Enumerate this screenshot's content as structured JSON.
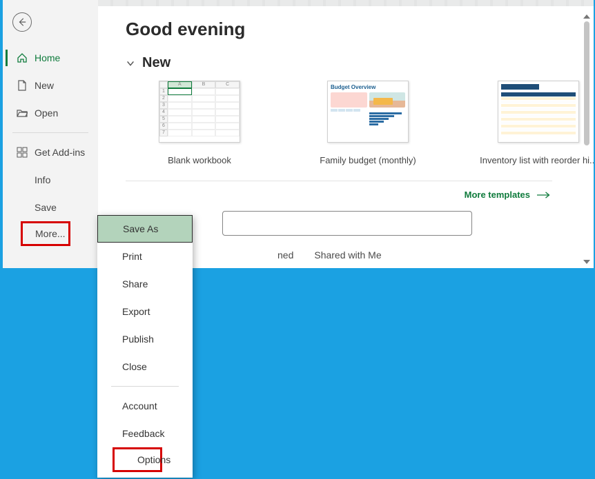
{
  "greeting": "Good evening",
  "section_new": "New",
  "sidebar": {
    "home": "Home",
    "new": "New",
    "open": "Open",
    "addins": "Get Add-ins",
    "info": "Info",
    "save": "Save",
    "more": "More..."
  },
  "templates": [
    {
      "label": "Blank workbook"
    },
    {
      "label": "Family budget (monthly)"
    },
    {
      "label": "Inventory list with reorder hi..."
    }
  ],
  "budget_thumb_title": "Budget Overview",
  "more_templates": "More templates",
  "tabs": {
    "pinned_partial": "ned",
    "shared": "Shared with Me"
  },
  "popup": {
    "save_as": "Save As",
    "print": "Print",
    "share": "Share",
    "export": "Export",
    "publish": "Publish",
    "close": "Close",
    "account": "Account",
    "feedback": "Feedback",
    "options": "Options"
  }
}
